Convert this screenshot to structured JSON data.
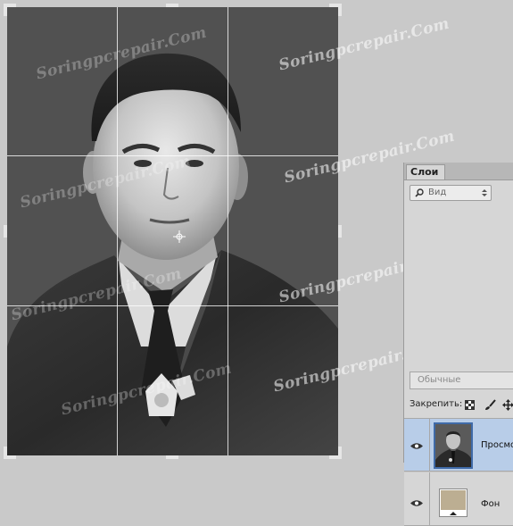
{
  "watermark": {
    "text": "Soringpcrepair.Com"
  },
  "layers_panel": {
    "tab_label": "Слои",
    "filter": {
      "label": "Вид",
      "icon": "search-icon"
    },
    "blend_mode": "Обычные",
    "lock_label": "Закрепить:",
    "lock_icons": [
      "lock-transparent-pixels-icon",
      "brush-icon",
      "move-icon"
    ],
    "layers": [
      {
        "name": "Просмотр",
        "visible": true,
        "selected": true,
        "thumb": "portrait-thumbnail"
      },
      {
        "name": "Фон",
        "visible": true,
        "selected": false,
        "thumb": "beige-fill-thumbnail",
        "thumb_color": "#bcae92"
      }
    ]
  },
  "colors": {
    "workspace_bg": "#c9c9c9",
    "canvas_bg": "#515151",
    "selected_layer": "#b8cde8",
    "background_layer_fill": "#bcae92"
  }
}
